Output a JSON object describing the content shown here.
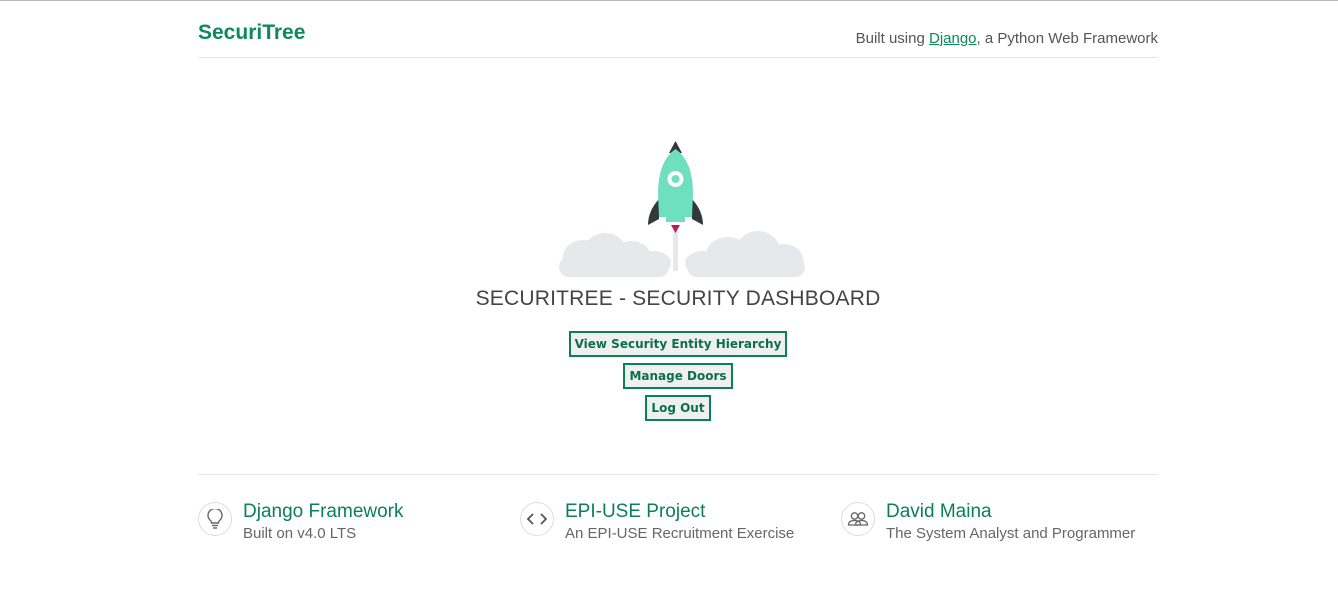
{
  "header": {
    "brand": "SecuriTree",
    "tagline_prefix": "Built using ",
    "tagline_link": "Django",
    "tagline_suffix": ", a Python Web Framework"
  },
  "hero": {
    "title": "SECURITREE - SECURITY DASHBOARD",
    "buttons": [
      "View Security Entity Hierarchy",
      "Manage Doors",
      "Log Out"
    ]
  },
  "footer": {
    "cards": [
      {
        "icon": "lightbulb-icon",
        "title": "Django Framework",
        "subtitle": "Built on v4.0 LTS"
      },
      {
        "icon": "code-icon",
        "title": "EPI-USE Project",
        "subtitle": "An EPI-USE Recruitment Exercise"
      },
      {
        "icon": "users-icon",
        "title": "David Maina",
        "subtitle": "The System Analyst and Programmer"
      }
    ]
  },
  "colors": {
    "accent": "#0c8a5c",
    "rocket": "#6ee0bf",
    "cloud": "#e6e8ec"
  }
}
